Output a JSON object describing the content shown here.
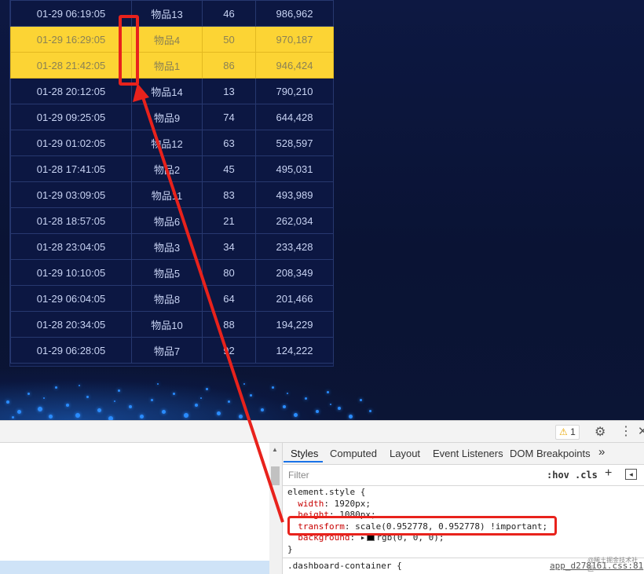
{
  "table": {
    "rows": [
      {
        "time": "01-29 06:19:05",
        "item": "物品13",
        "qty": "46",
        "amount": "986,962",
        "highlight": false
      },
      {
        "time": "01-29 16:29:05",
        "item": "物品4",
        "qty": "50",
        "amount": "970,187",
        "highlight": true
      },
      {
        "time": "01-28 21:42:05",
        "item": "物品1",
        "qty": "86",
        "amount": "946,424",
        "highlight": true
      },
      {
        "time": "01-28 20:12:05",
        "item": "物品14",
        "qty": "13",
        "amount": "790,210",
        "highlight": false
      },
      {
        "time": "01-29 09:25:05",
        "item": "物品9",
        "qty": "74",
        "amount": "644,428",
        "highlight": false
      },
      {
        "time": "01-29 01:02:05",
        "item": "物品12",
        "qty": "63",
        "amount": "528,597",
        "highlight": false
      },
      {
        "time": "01-28 17:41:05",
        "item": "物品2",
        "qty": "45",
        "amount": "495,031",
        "highlight": false
      },
      {
        "time": "01-29 03:09:05",
        "item": "物品11",
        "qty": "83",
        "amount": "493,989",
        "highlight": false
      },
      {
        "time": "01-28 18:57:05",
        "item": "物品6",
        "qty": "21",
        "amount": "262,034",
        "highlight": false
      },
      {
        "time": "01-28 23:04:05",
        "item": "物品3",
        "qty": "34",
        "amount": "233,428",
        "highlight": false
      },
      {
        "time": "01-29 10:10:05",
        "item": "物品5",
        "qty": "80",
        "amount": "208,349",
        "highlight": false
      },
      {
        "time": "01-29 06:04:05",
        "item": "物品8",
        "qty": "64",
        "amount": "201,466",
        "highlight": false
      },
      {
        "time": "01-28 20:34:05",
        "item": "物品10",
        "qty": "88",
        "amount": "194,229",
        "highlight": false
      },
      {
        "time": "01-29 06:28:05",
        "item": "物品7",
        "qty": "92",
        "amount": "124,222",
        "highlight": false
      }
    ]
  },
  "devtools": {
    "warning_count": "1",
    "tabs": [
      "Styles",
      "Computed",
      "Layout",
      "Event Listeners",
      "DOM Breakpoints"
    ],
    "more_tabs": "»",
    "filter_placeholder": "Filter",
    "hov": ":hov",
    "cls": ".cls",
    "plus": "+",
    "code": {
      "selector": "element.style {",
      "width_prop": "width",
      "width_val": "1920px;",
      "height_prop": "height",
      "height_val": "1080px;",
      "transform_prop": "transform",
      "transform_val": "scale(0.952778, 0.952778) !important;",
      "background_prop": "background",
      "background_val": "rgb(0, 0, 0);",
      "close": "}",
      "next_selector": ".dashboard-container {"
    },
    "source_link": "app_d278161.css:81",
    "watermark": "@稀土掘金技术社区"
  },
  "colors": {
    "highlight_row": "#fcd434",
    "annotation_red": "#e8221c",
    "accent_blue": "#1a73e8"
  }
}
